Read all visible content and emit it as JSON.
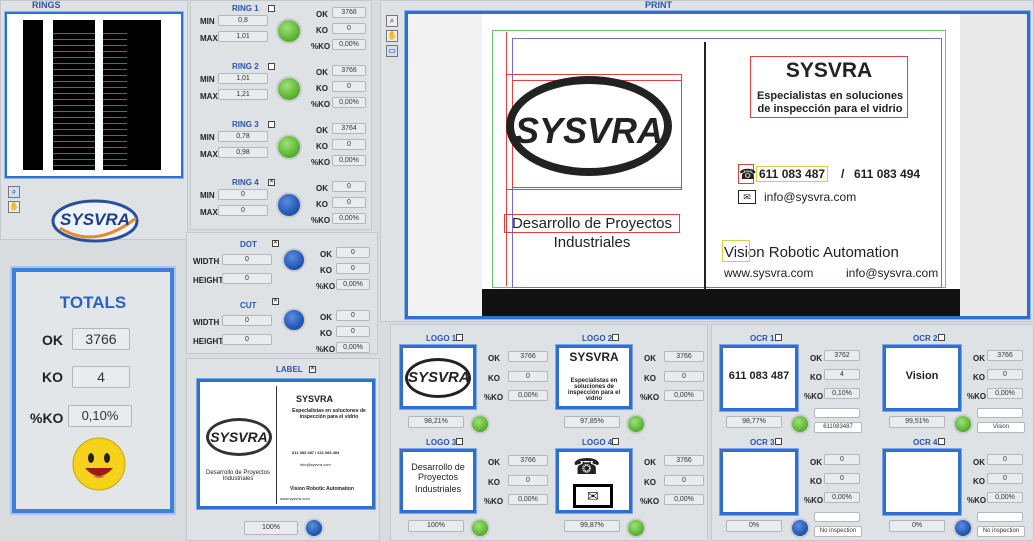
{
  "rings_panel": {
    "title": "RINGS"
  },
  "print_panel": {
    "title": "PRINT"
  },
  "label_panel": {
    "title": "LABEL",
    "percent": "100%"
  },
  "brand": {
    "logo_text": "SYSVRA"
  },
  "totals": {
    "title": "TOTALS",
    "ok_label": "OK",
    "ok": "3766",
    "ko_label": "KO",
    "ko": "4",
    "pko_label": "%KO",
    "pko": "0,10%"
  },
  "rings": [
    {
      "title": "RING 1",
      "min": "0,8",
      "max": "1,01",
      "ok": "3766",
      "ko": "0",
      "pko": "0,00%",
      "led": "green"
    },
    {
      "title": "RING 2",
      "min": "1,01",
      "max": "1,21",
      "ok": "3766",
      "ko": "0",
      "pko": "0,00%",
      "led": "green"
    },
    {
      "title": "RING 3",
      "min": "0,78",
      "max": "0,98",
      "ok": "3764",
      "ko": "0",
      "pko": "0,00%",
      "led": "green"
    },
    {
      "title": "RING 4",
      "min": "0",
      "max": "0",
      "ok": "0",
      "ko": "0",
      "pko": "0,00%",
      "led": "blue"
    }
  ],
  "labels": {
    "min": "MIN",
    "max": "MAX",
    "ok": "OK",
    "ko": "KO",
    "pko": "%KO",
    "width": "WIDTH",
    "height": "HEIGHT"
  },
  "dot": {
    "title": "DOT",
    "width": "0",
    "height": "0",
    "ok": "0",
    "ko": "0",
    "pko": "0,00%"
  },
  "cut": {
    "title": "CUT",
    "width": "0",
    "height": "0",
    "ok": "0",
    "ko": "0",
    "pko": "0,00%"
  },
  "card": {
    "company": "SYSVRA",
    "tagline": "Especialistas en soluciones de inspección para el vidrio",
    "phones": "611 083 487 / 611 083 494",
    "phone1": "611 083 487",
    "slash": "/",
    "phone2": "611 083 494",
    "email": "info@sysvra.com",
    "dev": "Desarrollo de Proyectos Industriales",
    "dev1": "Desarrollo de Proyectos",
    "dev2": "Industriales",
    "vra": "Vision Robotic Automation",
    "web": "www.sysvra.com"
  },
  "logos": [
    {
      "title": "LOGO 1",
      "ok": "3766",
      "ko": "0",
      "pko": "0,00%",
      "score": "98,21%"
    },
    {
      "title": "LOGO 2",
      "ok": "3766",
      "ko": "0",
      "pko": "0,00%",
      "score": "97,85%"
    },
    {
      "title": "LOGO 3",
      "ok": "3766",
      "ko": "0",
      "pko": "0,00%",
      "score": "100%"
    },
    {
      "title": "LOGO 4",
      "ok": "3766",
      "ko": "0",
      "pko": "0,00%",
      "score": "99,87%"
    }
  ],
  "logo_thumbs": {
    "l2_title": "SYSVRA",
    "l2_sub": "Especialistas en soluciones de inspección para el vidrio"
  },
  "ocr": [
    {
      "title": "OCR 1",
      "ok": "3762",
      "ko": "4",
      "pko": "0,10%",
      "score": "98,77%",
      "read": "611083487",
      "thumb": "611 083 487"
    },
    {
      "title": "OCR 2",
      "ok": "3766",
      "ko": "0",
      "pko": "0,00%",
      "score": "99,51%",
      "read": "Vision",
      "thumb": "Vision"
    },
    {
      "title": "OCR 3",
      "ok": "0",
      "ko": "0",
      "pko": "0,00%",
      "score": "0%",
      "read": "No inspection",
      "thumb": ""
    },
    {
      "title": "OCR 4",
      "ok": "0",
      "ko": "0",
      "pko": "0,00%",
      "score": "0%",
      "read": "No inspection",
      "thumb": ""
    }
  ]
}
